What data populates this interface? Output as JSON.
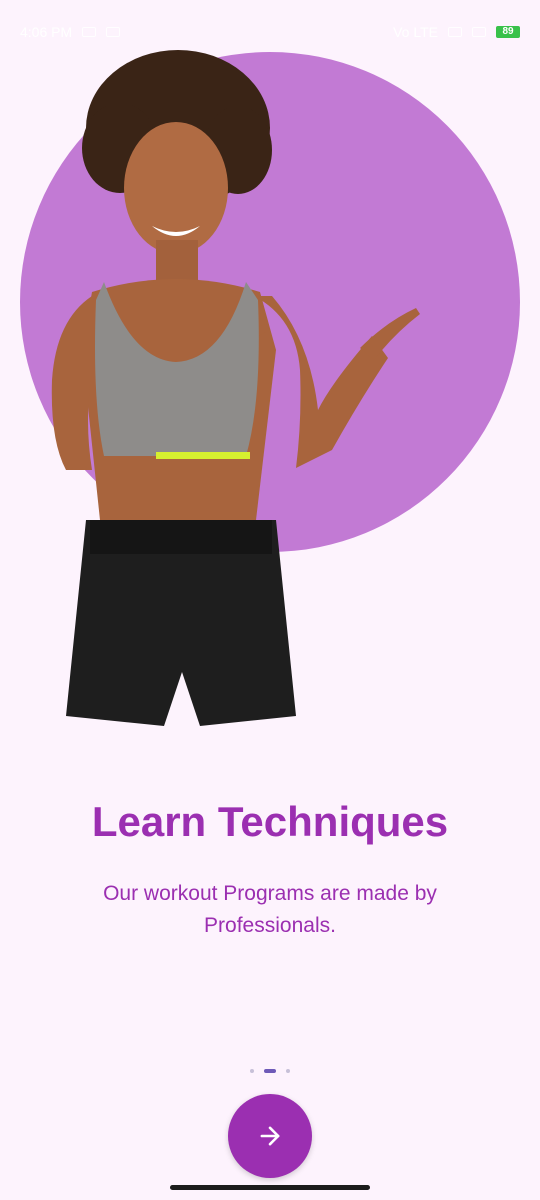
{
  "status_bar": {
    "time": "4:06 PM",
    "network": "Vo LTE",
    "battery": "89"
  },
  "onboarding": {
    "title": "Learn Techniques",
    "description": "Our workout Programs are  made by Professionals.",
    "page_indicator": {
      "current": 2,
      "total": 3
    },
    "next_button_icon": "arrow-right-icon"
  },
  "colors": {
    "accent": "#9b2fb1",
    "circle": "#c27ad4",
    "background": "#fdf3fd"
  }
}
